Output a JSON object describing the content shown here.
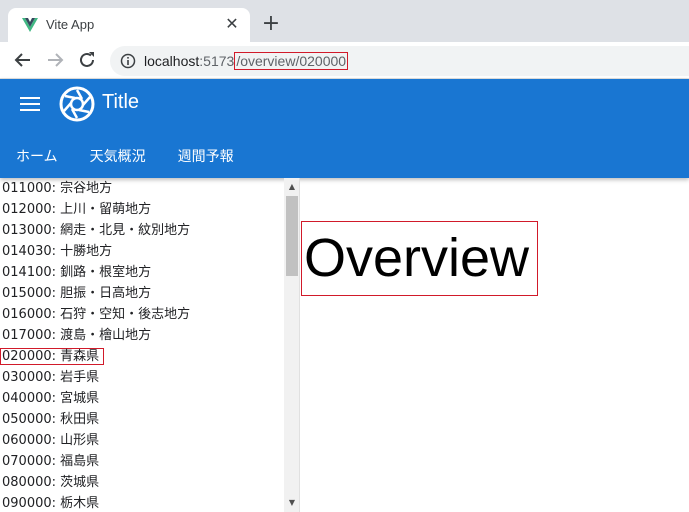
{
  "browser": {
    "tab_title": "Vite App",
    "tab_close": "✕",
    "new_tab": "+",
    "url_host": "localhost",
    "url_port": ":5173",
    "url_path": "/overview/020000"
  },
  "app": {
    "title": "Title",
    "nav": [
      {
        "label": "ホーム"
      },
      {
        "label": "天気概況"
      },
      {
        "label": "週間予報"
      }
    ]
  },
  "sidebar": {
    "items": [
      {
        "code": "011000",
        "name": "宗谷地方"
      },
      {
        "code": "012000",
        "name": "上川・留萌地方"
      },
      {
        "code": "013000",
        "name": "網走・北見・紋別地方"
      },
      {
        "code": "014030",
        "name": "十勝地方"
      },
      {
        "code": "014100",
        "name": "釧路・根室地方"
      },
      {
        "code": "015000",
        "name": "胆振・日高地方"
      },
      {
        "code": "016000",
        "name": "石狩・空知・後志地方"
      },
      {
        "code": "017000",
        "name": "渡島・檜山地方"
      },
      {
        "code": "020000",
        "name": "青森県"
      },
      {
        "code": "030000",
        "name": "岩手県"
      },
      {
        "code": "040000",
        "name": "宮城県"
      },
      {
        "code": "050000",
        "name": "秋田県"
      },
      {
        "code": "060000",
        "name": "山形県"
      },
      {
        "code": "070000",
        "name": "福島県"
      },
      {
        "code": "080000",
        "name": "茨城県"
      },
      {
        "code": "090000",
        "name": "栃木県"
      }
    ],
    "selected_code": "020000"
  },
  "main": {
    "heading": "Overview"
  },
  "colors": {
    "appbar": "#1976d2",
    "highlight": "#d11a2a"
  }
}
